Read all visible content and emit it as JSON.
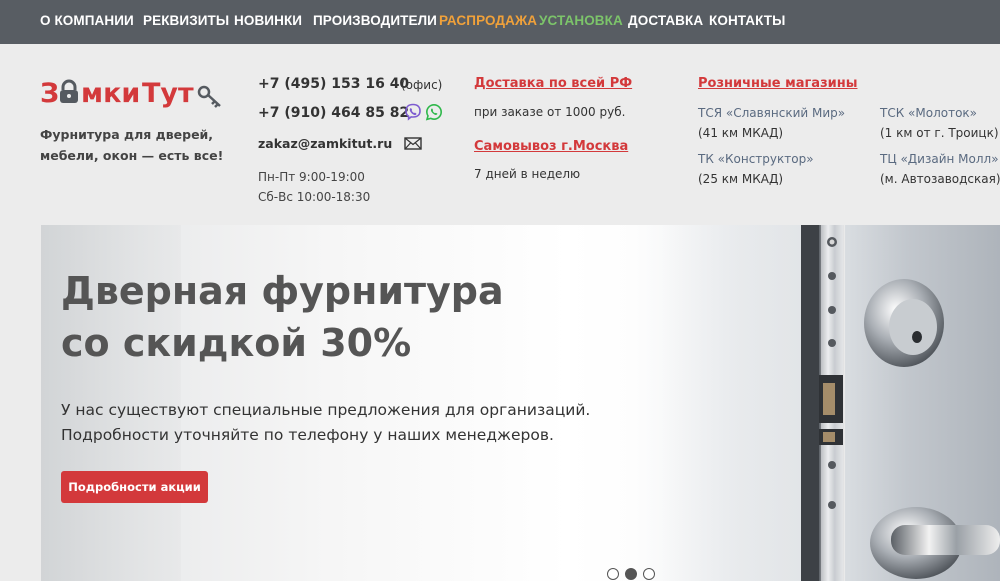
{
  "nav": {
    "items": [
      {
        "label": "О КОМПАНИИ",
        "color": "#ffffff"
      },
      {
        "label": "РЕКВИЗИТЫ",
        "color": "#ffffff"
      },
      {
        "label": "НОВИНКИ",
        "color": "#ffffff"
      },
      {
        "label": "ПРОИЗВОДИТЕЛИ",
        "color": "#ffffff"
      },
      {
        "label": "РАСПРОДАЖА",
        "color": "#f0a13a"
      },
      {
        "label": "УСТАНОВКА",
        "color": "#7cc46a"
      },
      {
        "label": "ДОСТАВКА",
        "color": "#ffffff"
      },
      {
        "label": "КОНТАКТЫ",
        "color": "#ffffff"
      }
    ]
  },
  "brand": {
    "logo_text_1": "З",
    "logo_text_2": "мки",
    "logo_text_3": "Тут",
    "tagline_line1": "Фурнитура для дверей,",
    "tagline_line2": "мебели, окон — есть все!",
    "logo_red": "#d3393b",
    "logo_dark": "#555a60"
  },
  "contacts": {
    "phone1": "+7 (495) 153 16 40",
    "phone1_note": "(офис)",
    "phone2": "+7 (910) 464 85 82",
    "email": "zakaz@zamkitut.ru",
    "hours1": "Пн-Пт 9:00-19:00",
    "hours2": "Сб-Вс 10:00-18:30",
    "viber_icon": "viber-icon",
    "whatsapp_icon": "whatsapp-icon",
    "mail_icon": "envelope-icon"
  },
  "delivery": {
    "link1": "Доставка по всей РФ",
    "text1": "при заказе от 1000 руб.",
    "link2": "Самовывоз г.Москва",
    "text2": "7 дней в неделю"
  },
  "stores": {
    "heading": "Розничные магазины",
    "items": [
      {
        "name": "ТСЯ «Славянский Мир»",
        "addr": "(41 км МКАД)"
      },
      {
        "name": "ТСК «Молоток»",
        "addr": "(1 км от г. Троицк)"
      },
      {
        "name": "ТК «Конструктор»",
        "addr": "(25 км МКАД)"
      },
      {
        "name": "ТЦ «Дизайн Молл»",
        "addr": "(м. Автозаводская)"
      }
    ]
  },
  "hero": {
    "title_line1": "Дверная фурнитура",
    "title_line2": "со скидкой 30%",
    "text_line1": "У нас существуют специальные предложения для организаций.",
    "text_line2": "Подробности уточняйте по телефону у наших менеджеров.",
    "button_label": "Подробности акции",
    "slides": 3,
    "active_slide": 2
  }
}
